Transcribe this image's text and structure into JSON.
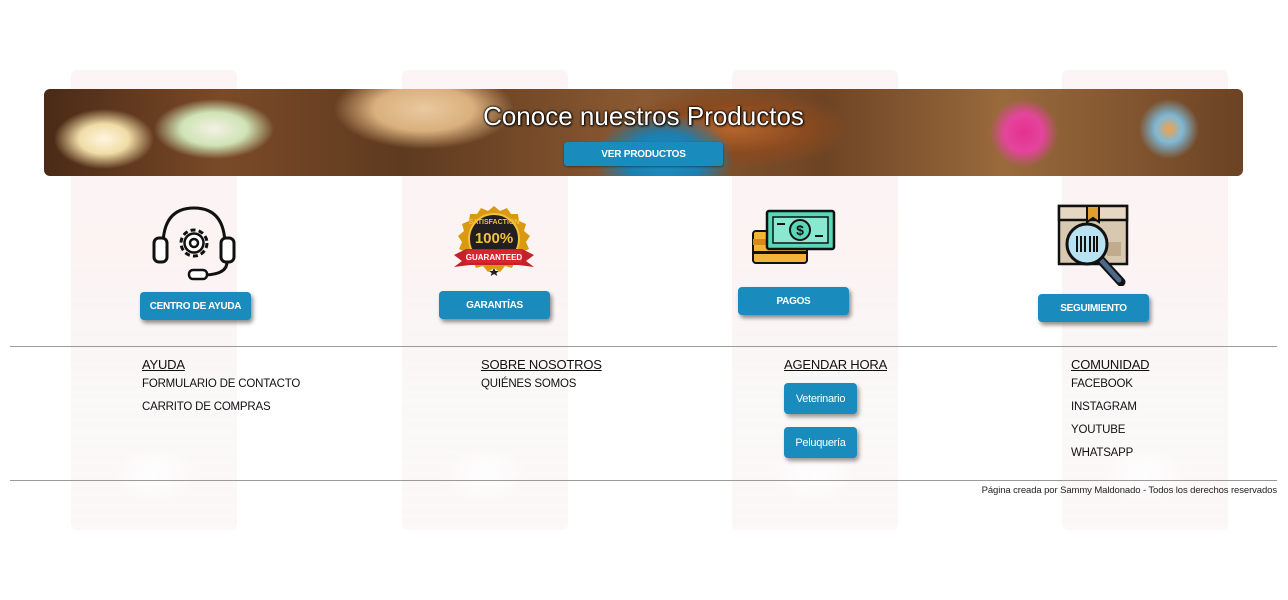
{
  "banner": {
    "title": "Conoce nuestros Productos",
    "button_label": "VER PRODUCTOS"
  },
  "features": [
    {
      "icon": "headset-gear-icon",
      "label": "CENTRO DE AYUDA"
    },
    {
      "icon": "satisfaction-guaranteed-badge-icon",
      "label": "GARANTÍAS",
      "badge_text_top": "SATISFACTION",
      "badge_text_mid": "100%",
      "badge_text_ribbon": "GUARANTEED"
    },
    {
      "icon": "money-card-icon",
      "label": "PAGOS"
    },
    {
      "icon": "package-search-icon",
      "label": "SEGUIMIENTO"
    }
  ],
  "footer": {
    "ayuda": {
      "heading": "AYUDA",
      "links": [
        "FORMULARIO DE CONTACTO",
        "CARRITO DE COMPRAS"
      ]
    },
    "sobre": {
      "heading": "SOBRE NOSOTROS",
      "links": [
        "QUIÉNES SOMOS"
      ]
    },
    "agendar": {
      "heading": "AGENDAR HORA",
      "buttons": [
        "Veterinario",
        "Peluquería"
      ]
    },
    "comunidad": {
      "heading": "COMUNIDAD",
      "links": [
        "FACEBOOK",
        "INSTAGRAM",
        "YOUTUBE",
        "WHATSAPP"
      ]
    }
  },
  "credits": "Página creada por Sammy Maldonado - Todos los derechos reservados",
  "colors": {
    "button_blue": "#1a8bbd",
    "divider": "#9a9a9a"
  }
}
